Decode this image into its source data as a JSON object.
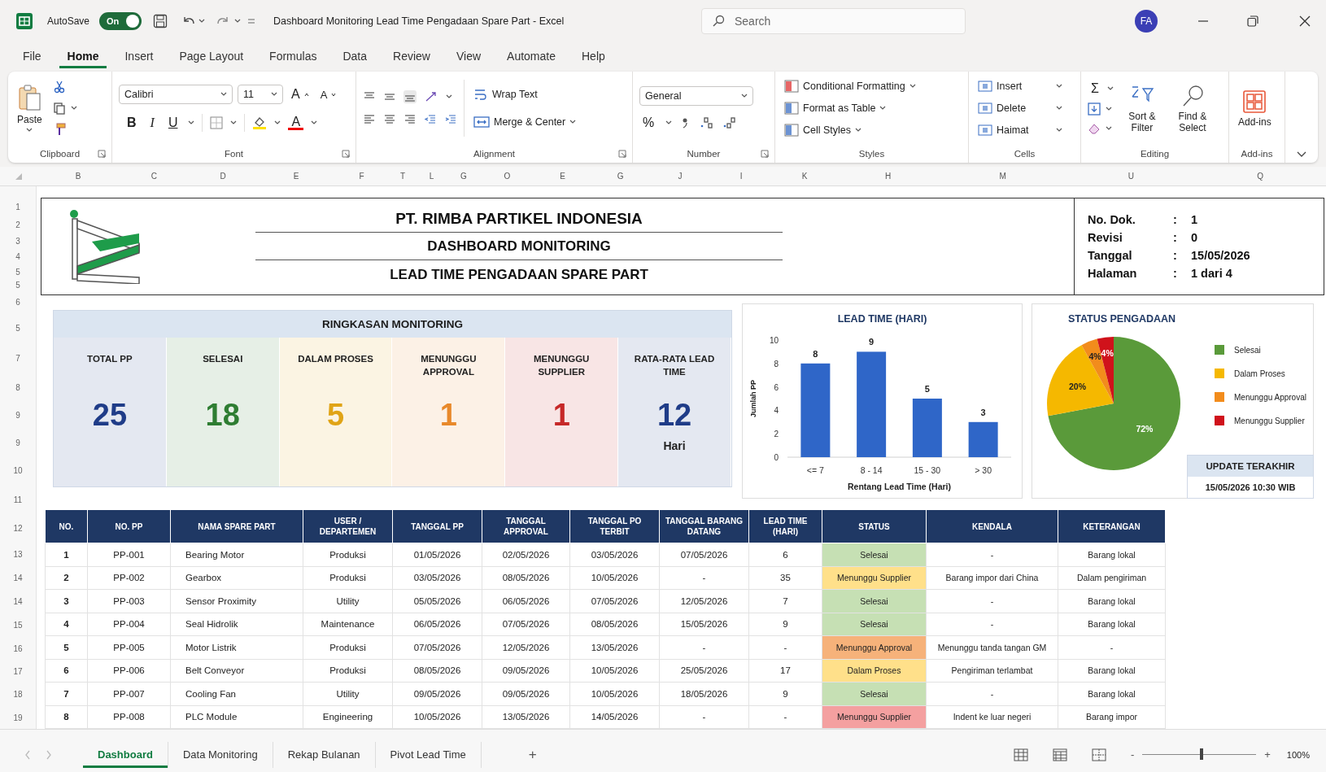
{
  "window": {
    "title": "Dashboard Monitoring Lead Time Pengadaan Spare Part - Excel",
    "autosave": {
      "label": "AutoSave",
      "on": true,
      "state_text": "On"
    },
    "search": {
      "placeholder": "Search"
    },
    "user": {
      "initials": "FA"
    }
  },
  "menu_tabs": [
    {
      "label": "File",
      "selected": false
    },
    {
      "label": "Home",
      "selected": true
    },
    {
      "label": "Insert",
      "selected": false
    },
    {
      "label": "Page Layout",
      "selected": false
    },
    {
      "label": "Formulas",
      "selected": false
    },
    {
      "label": "Data",
      "selected": false
    },
    {
      "label": "Review",
      "selected": false
    },
    {
      "label": "View",
      "selected": false
    },
    {
      "label": "Automate",
      "selected": false
    },
    {
      "label": "Help",
      "selected": false
    }
  ],
  "ribbon": {
    "clipboard": {
      "paste": "Paste",
      "label": "Clipboard"
    },
    "font": {
      "name": "Calibri",
      "size": "11",
      "grow": "A",
      "shrink": "A",
      "bold": "B",
      "italic": "I",
      "underline": "U",
      "font_color": "A",
      "label": "Font"
    },
    "alignment": {
      "wrap": "Wrap Text",
      "merge": "Merge & Center",
      "label": "Alignment"
    },
    "number": {
      "format": "General",
      "percent": "%",
      "label": "Number"
    },
    "styles": {
      "items": [
        "Conditional Formatting",
        "Format as Table",
        "Cell Styles"
      ],
      "label": "Styles"
    },
    "cells": {
      "items": [
        "Insert",
        "Delete",
        "Haimat"
      ],
      "label": "Cells"
    },
    "editing": {
      "sum": "Σ",
      "sort": "Sort & Filter",
      "find": "Find & Select",
      "label": "Editing"
    },
    "addins": {
      "button": "Add-ins",
      "label": "Add-ins"
    }
  },
  "column_headers": [
    "B",
    "C",
    "D",
    "E",
    "F",
    "T",
    "L",
    "G",
    "O",
    "E",
    "G",
    "J",
    "I",
    "K",
    "H",
    "M",
    "U",
    "Q"
  ],
  "row_numbers": [
    "1",
    "2",
    "3",
    "4",
    "5",
    "5",
    "6",
    "5",
    "7",
    "8",
    "9",
    "9",
    "10",
    "11",
    "12",
    "13",
    "14",
    "14",
    "15",
    "16",
    "17",
    "18",
    "19"
  ],
  "header": {
    "company": "PT. RIMBA PARTIKEL INDONESIA",
    "title": "DASHBOARD MONITORING",
    "subtitle": "LEAD TIME PENGADAAN SPARE PART",
    "doc_info": [
      {
        "label": "No. Dok.",
        "colon": ":",
        "value": "1"
      },
      {
        "label": "Revisi",
        "colon": ":",
        "value": "0"
      },
      {
        "label": "Tanggal",
        "colon": ":",
        "value": "15/05/2026"
      },
      {
        "label": "Halaman",
        "colon": ":",
        "value": "1 dari 4"
      }
    ]
  },
  "summary": {
    "title": "RINGKASAN MONITORING",
    "cards": [
      {
        "label": "TOTAL PP",
        "value": "25",
        "color": "#1f3c88"
      },
      {
        "label": "SELESAI",
        "value": "18",
        "color": "#2e7d32"
      },
      {
        "label": "DALAM PROSES",
        "value": "5",
        "color": "#e0a416"
      },
      {
        "label": "MENUNGGU APPROVAL",
        "value": "1",
        "color": "#e8892b"
      },
      {
        "label": "MENUNGGU SUPPLIER",
        "value": "1",
        "color": "#c62828"
      },
      {
        "label": "RATA-RATA LEAD TIME",
        "value": "12",
        "unit": "Hari",
        "color": "#1f3c88"
      }
    ]
  },
  "lead_time_chart": {
    "chart_data": {
      "type": "bar",
      "title": "LEAD TIME (HARI)",
      "xlabel": "Rentang Lead Time (Hari)",
      "ylabel": "Jumlah PP",
      "categories": [
        "<= 7",
        "8 - 14",
        "15 - 30",
        "> 30"
      ],
      "series": [
        {
          "color": "#2f66c8",
          "values": [
            8,
            9,
            5,
            3
          ]
        }
      ],
      "ylim": [
        0,
        10
      ],
      "yticks": [
        0,
        2,
        4,
        6,
        8,
        10
      ],
      "data_labels": true
    }
  },
  "status_chart": {
    "chart_data": {
      "type": "pie",
      "title": "STATUS PENGADAAN",
      "categories": [
        "Selesai",
        "Dalam Proses",
        "Menunggu Approval",
        "Menunggu Supplier"
      ],
      "values": [
        72,
        20,
        4,
        4
      ],
      "value_labels": [
        "72%",
        "20%",
        "4%",
        "4%"
      ],
      "legend": "right"
    },
    "legend": [
      {
        "color": "#5a9a3a"
      },
      {
        "color": "#f5b800"
      },
      {
        "color": "#f28c1c"
      },
      {
        "color": "#d0121b"
      }
    ]
  },
  "update": {
    "title": "UPDATE TERAKHIR",
    "value": "15/05/2026 10:30 WIB"
  },
  "table": {
    "columns": [
      {
        "label": "NO."
      },
      {
        "label": "NO. PP"
      },
      {
        "label": "NAMA SPARE PART",
        "kind": "left"
      },
      {
        "label": "USER / DEPARTEMEN"
      },
      {
        "label": "TANGGAL PP"
      },
      {
        "label": "TANGGAL APPROVAL"
      },
      {
        "label": "TANGGAL PO TERBIT"
      },
      {
        "label": "TANGGAL BARANG DATANG"
      },
      {
        "label": "LEAD TIME (HARI)"
      },
      {
        "label": "STATUS",
        "kind": "status"
      },
      {
        "label": "KENDALA"
      },
      {
        "label": "KETERANGAN"
      }
    ],
    "rows": [
      {
        "cells": [
          "1",
          "PP-001",
          "Bearing Motor",
          "Produksi",
          "01/05/2026",
          "02/05/2026",
          "03/05/2026",
          "07/05/2026",
          "6",
          "Selesai",
          "-",
          "Barang lokal"
        ],
        "color": "#c6e0b4"
      },
      {
        "cells": [
          "2",
          "PP-002",
          "Gearbox",
          "Produksi",
          "03/05/2026",
          "08/05/2026",
          "10/05/2026",
          "-",
          "35",
          "Menunggu Supplier",
          "Barang impor dari China",
          "Dalam pengiriman"
        ],
        "color": "#ffe08a"
      },
      {
        "cells": [
          "3",
          "PP-003",
          "Sensor Proximity",
          "Utility",
          "05/05/2026",
          "06/05/2026",
          "07/05/2026",
          "12/05/2026",
          "7",
          "Selesai",
          "-",
          "Barang lokal"
        ],
        "color": "#c6e0b4"
      },
      {
        "cells": [
          "4",
          "PP-004",
          "Seal Hidrolik",
          "Maintenance",
          "06/05/2026",
          "07/05/2026",
          "08/05/2026",
          "15/05/2026",
          "9",
          "Selesai",
          "-",
          "Barang lokal"
        ],
        "color": "#c6e0b4"
      },
      {
        "cells": [
          "5",
          "PP-005",
          "Motor Listrik",
          "Produksi",
          "07/05/2026",
          "12/05/2026",
          "13/05/2026",
          "-",
          "-",
          "Menunggu Approval",
          "Menunggu tanda tangan GM",
          "-"
        ],
        "color": "#f6b27a"
      },
      {
        "cells": [
          "6",
          "PP-006",
          "Belt Conveyor",
          "Produksi",
          "08/05/2026",
          "09/05/2026",
          "10/05/2026",
          "25/05/2026",
          "17",
          "Dalam Proses",
          "Pengiriman terlambat",
          "Barang lokal"
        ],
        "color": "#ffe08a"
      },
      {
        "cells": [
          "7",
          "PP-007",
          "Cooling Fan",
          "Utility",
          "09/05/2026",
          "09/05/2026",
          "10/05/2026",
          "18/05/2026",
          "9",
          "Selesai",
          "-",
          "Barang lokal"
        ],
        "color": "#c6e0b4"
      },
      {
        "cells": [
          "8",
          "PP-008",
          "PLC Module",
          "Engineering",
          "10/05/2026",
          "13/05/2026",
          "14/05/2026",
          "-",
          "-",
          "Menunggu Supplier",
          "Indent ke luar negeri",
          "Barang impor"
        ],
        "color": "#f4a0a0"
      }
    ]
  },
  "sheet_tabs": [
    {
      "label": "Dashboard",
      "selected": true
    },
    {
      "label": "Data Monitoring",
      "selected": false
    },
    {
      "label": "Rekap Bulanan",
      "selected": false
    },
    {
      "label": "Pivot Lead Time",
      "selected": false
    }
  ],
  "new_sheet": "+",
  "status_bar": {
    "zoom_out": "-",
    "zoom_in": "+",
    "zoom": "100%",
    "zoom_slider": {
      "level": 0.52
    }
  }
}
